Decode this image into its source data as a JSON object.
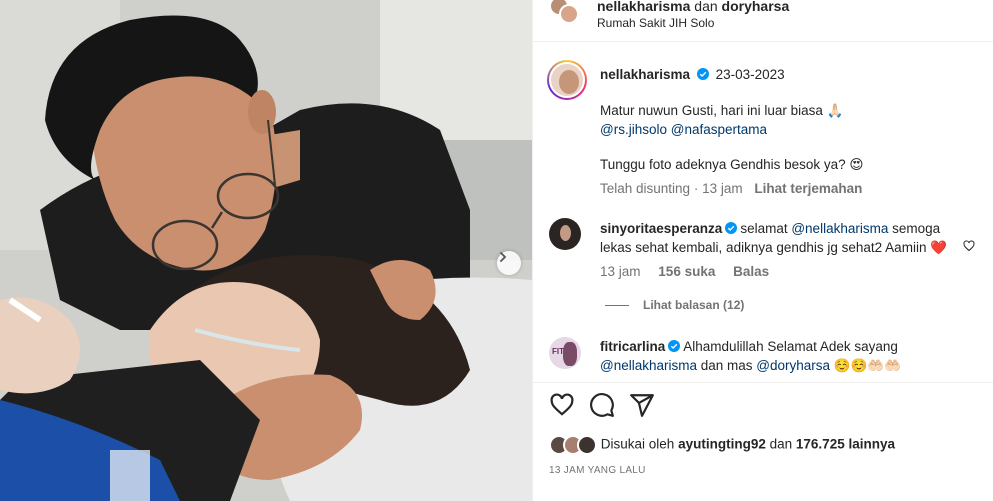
{
  "header": {
    "user1": "nellakharisma",
    "joiner": "dan",
    "user2": "doryharsa",
    "location": "Rumah Sakit JIH Solo"
  },
  "caption": {
    "username": "nellakharisma",
    "date": "23-03-2023",
    "line1": "Matur nuwun Gusti, hari ini luar biasa 🙏🏻",
    "mention1": "@rs.jihsolo",
    "mention2": "@nafaspertama",
    "line2": "Tunggu foto adeknya Gendhis besok ya? 😍",
    "edited": "Telah disunting",
    "time": "13 jam",
    "translate": "Lihat terjemahan"
  },
  "comments": [
    {
      "username": "sinyoritaesperanza",
      "text_pre": "selamat ",
      "mention": "@nellakharisma",
      "text_post": " semoga lekas sehat kembali, adiknya gendhis jg sehat2 Aamiin ❤️",
      "time": "13 jam",
      "likes": "156 suka",
      "reply": "Balas",
      "view_replies": "Lihat balasan (12)"
    },
    {
      "username": "fitricarlina",
      "text_pre": "Alhamdulillah Selamat Adek sayang ",
      "mention": "@nellakharisma",
      "text_mid": " dan mas ",
      "mention2": "@doryharsa",
      "text_post": " ☺️☺️🤲🏻🤲🏻"
    }
  ],
  "likes": {
    "prefix": "Disukai oleh",
    "user": "ayutingting92",
    "joiner": "dan",
    "count": "176.725 lainnya"
  },
  "time_ago": "13 JAM YANG LALU",
  "icons": [
    "heart-icon",
    "comment-icon",
    "share-icon",
    "chevron-right-icon",
    "verified-icon"
  ],
  "colors": {
    "verified": "#0095f6",
    "mention": "#00376b",
    "muted": "#737373",
    "heart": "#ed4956"
  }
}
